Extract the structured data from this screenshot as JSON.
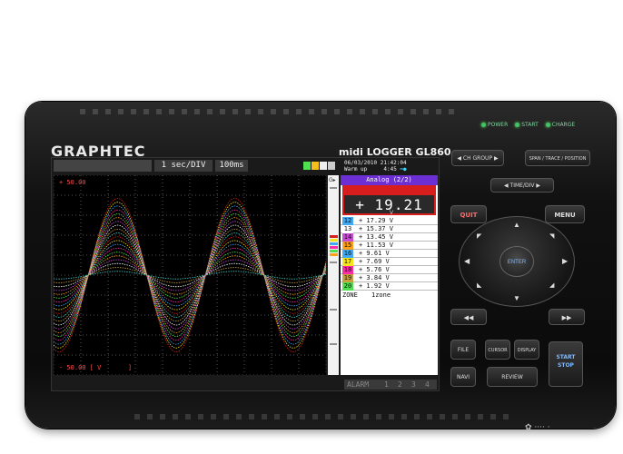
{
  "device": {
    "brand": "GRAPHTEC",
    "model": "midi LOGGER GL860",
    "leds": [
      "POWER",
      "START",
      "CHARGE"
    ]
  },
  "screen": {
    "header": {
      "time_div": "1 sec/DIV",
      "sampling": "100ms",
      "date": "06/03/2010 21:42:04",
      "status": "Warm up",
      "status_time": "4:45"
    },
    "plot": {
      "y_top": "+ 50.00",
      "y_bottom": "- 50.00 [ V",
      "y_bottom_end": "]"
    },
    "panel": {
      "title": "Analog (2/2)",
      "big_value": "+ 19.21",
      "big_unit": "V",
      "channels": [
        {
          "ch": "12",
          "value": "+ 17.29  V",
          "color": "#3fa9f5"
        },
        {
          "ch": "13",
          "value": "+ 15.37  V",
          "color": "#ffffff"
        },
        {
          "ch": "14",
          "value": "+ 13.45  V",
          "color": "#c84bd3"
        },
        {
          "ch": "15",
          "value": "+ 11.53  V",
          "color": "#ff9f1a"
        },
        {
          "ch": "16",
          "value": "+  9.61  V",
          "color": "#3fa9f5"
        },
        {
          "ch": "17",
          "value": "+  7.69  V",
          "color": "#f5e51a"
        },
        {
          "ch": "18",
          "value": "+  5.76  V",
          "color": "#ff2aa8"
        },
        {
          "ch": "19",
          "value": "+  3.84  V",
          "color": "#c8a040"
        },
        {
          "ch": "20",
          "value": "+  1.92  V",
          "color": "#4fe04f"
        }
      ],
      "zone_label": "ZONE",
      "zone_value": "1zone"
    },
    "alarm": {
      "label": "ALARM",
      "items": [
        "1",
        "2",
        "3",
        "4"
      ]
    }
  },
  "controls": {
    "ch_group": "◀ CH GROUP ▶",
    "span": "SPAN / TRACE / POSITION",
    "time_div": "◀ TIME/DIV ▶",
    "quit": "QUIT",
    "menu": "MENU",
    "enter": "ENTER",
    "rewind": "◀◀",
    "forward": "▶▶",
    "file": "FILE",
    "cursor": "CURSOR",
    "display": "DISPLAY",
    "navi": "NAVI",
    "review": "REVIEW",
    "start_stop_1": "START",
    "start_stop_2": "STOP"
  },
  "colors": {
    "accent_purple": "#6b2fd3",
    "highlight_red": "#d81d1d",
    "led_green": "#3fc46a"
  },
  "chart_data": {
    "type": "line",
    "x_range": [
      0,
      10
    ],
    "ylim": [
      -50,
      50
    ],
    "grid": true,
    "series": [
      {
        "amplitude": 38.4
      },
      {
        "amplitude": 36.5
      },
      {
        "amplitude": 34.6
      },
      {
        "amplitude": 32.6
      },
      {
        "amplitude": 30.7
      },
      {
        "amplitude": 28.8
      },
      {
        "amplitude": 26.9
      },
      {
        "amplitude": 25.0
      },
      {
        "amplitude": 23.0
      },
      {
        "amplitude": 21.1
      },
      {
        "amplitude": 19.2
      },
      {
        "amplitude": 17.3
      },
      {
        "amplitude": 15.4
      },
      {
        "amplitude": 13.5
      },
      {
        "amplitude": 11.5
      },
      {
        "amplitude": 9.6
      },
      {
        "amplitude": 7.7
      },
      {
        "amplitude": 5.8
      },
      {
        "amplitude": 3.8
      },
      {
        "amplitude": 1.9
      }
    ],
    "series_colors": [
      "#d81d1d",
      "#f5e51a",
      "#3fa9f5",
      "#ff2aa8",
      "#4fe04f",
      "#ff9f1a",
      "#c84bd3",
      "#ffffff",
      "#c8a040",
      "#3fd3c8"
    ]
  }
}
